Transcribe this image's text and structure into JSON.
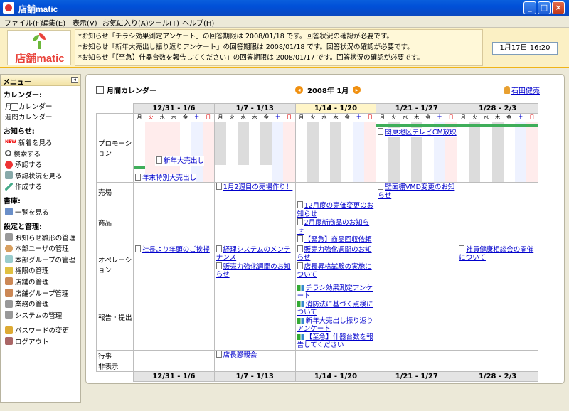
{
  "window": {
    "title": "店舗matic"
  },
  "menu": [
    "ファイル(F)",
    "編集(E)",
    "表示(V)",
    "お気に入り(A)",
    "ツール(T)",
    "ヘルプ(H)"
  ],
  "header": {
    "logo_text": "店舗matic",
    "notices": [
      "*お知らせ「チラシ効果測定アンケート」の回答期限は 2008/01/18 です。回答状況の確認が必要です。",
      "*お知らせ「新年大売出し振り返りアンケート」の回答期限は 2008/01/18 です。回答状況の確認が必要です。",
      "*お知らせ「【至急】什器台数を報告してください」の回答期限は 2008/01/17 です。回答状況の確認が必要です。"
    ],
    "clock": "1月17日 16:20"
  },
  "sidebar": {
    "title": "メニュー",
    "collapse": "◂",
    "sections": [
      {
        "label": "カレンダー:",
        "items": [
          {
            "label": "月間カレンダー",
            "icon": "calendar-icon"
          },
          {
            "label": "週間カレンダー",
            "icon": "calendar-week-icon"
          }
        ]
      },
      {
        "label": "お知らせ:",
        "items": [
          {
            "label": "新着を見る",
            "icon": "new-icon"
          },
          {
            "label": "検索する",
            "icon": "search-icon"
          },
          {
            "label": "承認する",
            "icon": "approve-icon"
          },
          {
            "label": "承認状況を見る",
            "icon": "status-icon"
          },
          {
            "label": "作成する",
            "icon": "pencil-icon"
          }
        ]
      },
      {
        "label": "書庫:",
        "items": [
          {
            "label": "一覧を見る",
            "icon": "box-icon"
          }
        ]
      },
      {
        "label": "設定と管理:",
        "items": [
          {
            "label": "お知らせ雛形の管理",
            "icon": "gear-icon"
          },
          {
            "label": "本部ユーザの管理",
            "icon": "user-icon"
          },
          {
            "label": "本部グループの管理",
            "icon": "group-icon"
          },
          {
            "label": "権限の管理",
            "icon": "key-icon"
          },
          {
            "label": "店舗の管理",
            "icon": "store-icon"
          },
          {
            "label": "店舗グループ管理",
            "icon": "store-group-icon"
          },
          {
            "label": "業務の管理",
            "icon": "work-icon"
          },
          {
            "label": "システムの管理",
            "icon": "system-icon"
          }
        ]
      },
      {
        "label": "",
        "items": [
          {
            "label": "パスワードの変更",
            "icon": "lock-icon"
          },
          {
            "label": "ログアウト",
            "icon": "door-icon"
          }
        ]
      }
    ]
  },
  "main": {
    "title": "月間カレンダー",
    "month": "2008年 1月",
    "prev": "◂",
    "next": "▸",
    "user": "石田健売",
    "weekdays": [
      "月",
      "火",
      "水",
      "木",
      "金",
      "土",
      "日"
    ],
    "weeks": [
      "12/31 - 1/6",
      "1/7 - 1/13",
      "1/14 - 1/20",
      "1/21 - 1/27",
      "1/28 - 2/3"
    ],
    "current_week_index": 2,
    "categories": [
      "プロモーション",
      "売場",
      "商品",
      "オペレーション",
      "報告・提出",
      "行事",
      "非表示"
    ],
    "events": {
      "promo": {
        "w0_a": "新年大売出し",
        "w0_b": "年末特別大売出し",
        "w3": "関東地区テレビCM放映"
      },
      "uriba": {
        "w1": "1月2週目の売場作り！",
        "w3": "壁面棚VMD変更のお知らせ"
      },
      "shohin": {
        "w2": [
          "12月度の売価変更のお知らせ",
          "2月度新商品のお知らせ",
          "【緊急】商品回収依頼"
        ]
      },
      "ope": {
        "w0": "社長より年頭のご挨拶",
        "w1": [
          "経理システムのメンテナンス",
          "販売力強化週間のお知らせ"
        ],
        "w2": [
          "販売力強化週間のお知らせ",
          "店長昇格試験の実施について"
        ],
        "w4": "社員健康相談会の開催について"
      },
      "report": {
        "w2": [
          "チラシ効果測定アンケート",
          "消防法に基づく点検について",
          "新年大売出し振り返りアンケート",
          "【至急】什器台数を報告してください"
        ]
      },
      "gyoji": {
        "w1": "店長懇親会"
      }
    }
  }
}
